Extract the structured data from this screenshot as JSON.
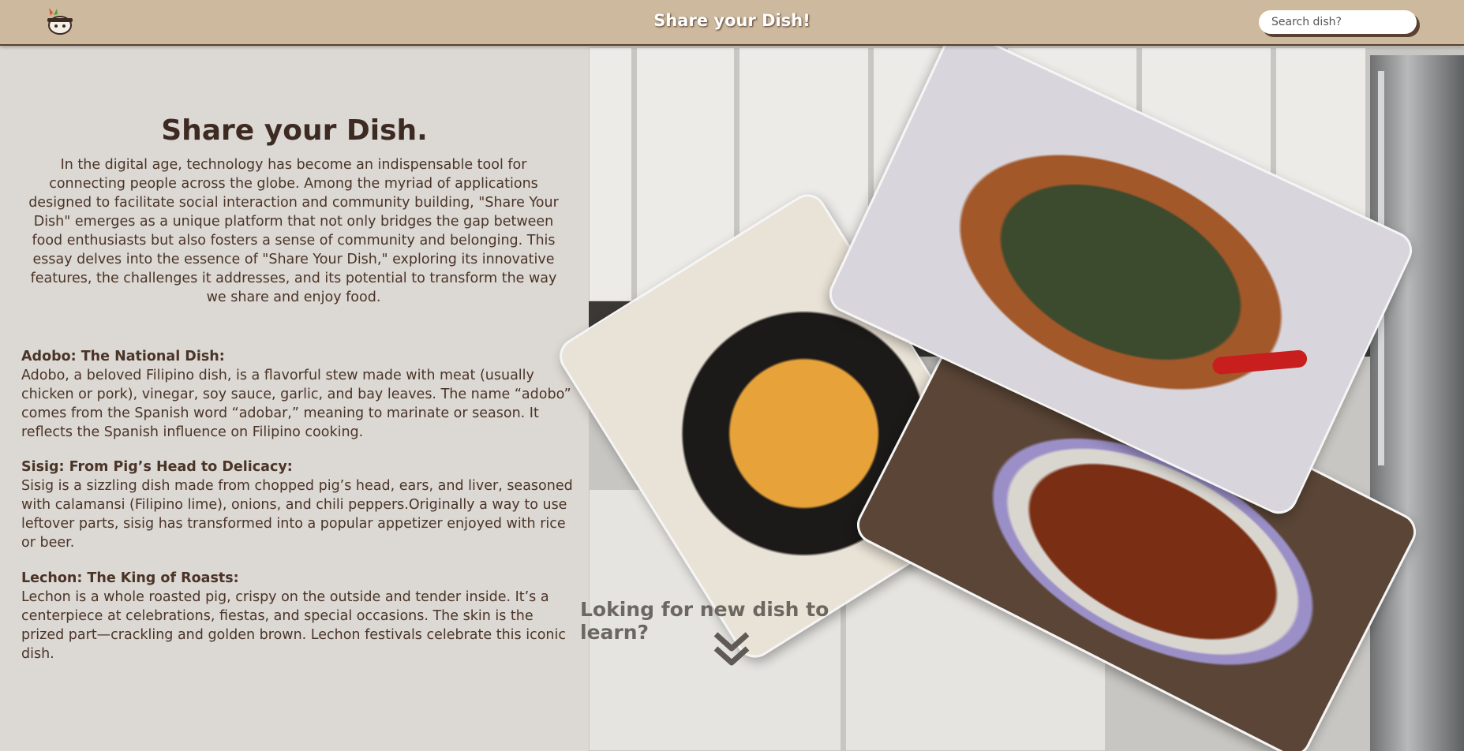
{
  "header": {
    "logo_icon": "chef-pot-icon",
    "title": "Share your Dish!",
    "search_placeholder": "Search dish?"
  },
  "intro": {
    "title": "Share your Dish.",
    "body": "In the digital age, technology has become an indispensable tool for connecting people across the globe. Among the myriad of applications designed to facilitate social interaction and community building, \"Share Your Dish\" emerges as a unique platform that not only bridges the gap between food enthusiasts but also fosters a sense of community and belonging. This essay delves into the essence of \"Share Your Dish,\" exploring its innovative features, the challenges it addresses, and its potential to transform the way we share and enjoy food."
  },
  "sections": [
    {
      "title": "Adobo: The National Dish:",
      "body": "Adobo, a beloved Filipino dish, is a flavorful stew made with meat (usually chicken or pork), vinegar, soy sauce, garlic, and bay leaves. The name “adobo” comes from the Spanish word “adobar,” meaning to marinate or season. It reflects the Spanish influence on Filipino cooking."
    },
    {
      "title": "Sisig: From Pig’s Head to Delicacy:",
      "body": "Sisig is a sizzling dish made from chopped pig’s head, ears, and liver, seasoned with calamansi (Filipino lime), onions, and chili peppers.Originally a way to use leftover parts, sisig has transformed into a popular appetizer enjoyed with rice or beer."
    },
    {
      "title": "Lechon: The King of Roasts:",
      "body": "Lechon is a whole roasted pig, crispy on the outside and tender inside. It’s a centerpiece at celebrations, fiestas, and special occasions. The skin is the prized part—crackling and golden brown. Lechon festivals celebrate this iconic dish."
    }
  ],
  "cta": {
    "text": "Loking for new dish to learn?",
    "icon": "double-chevron-down-icon"
  },
  "colors": {
    "header_bg": "#cdb99d",
    "panel_bg": "#dcd8d3",
    "text": "#4a3428"
  }
}
